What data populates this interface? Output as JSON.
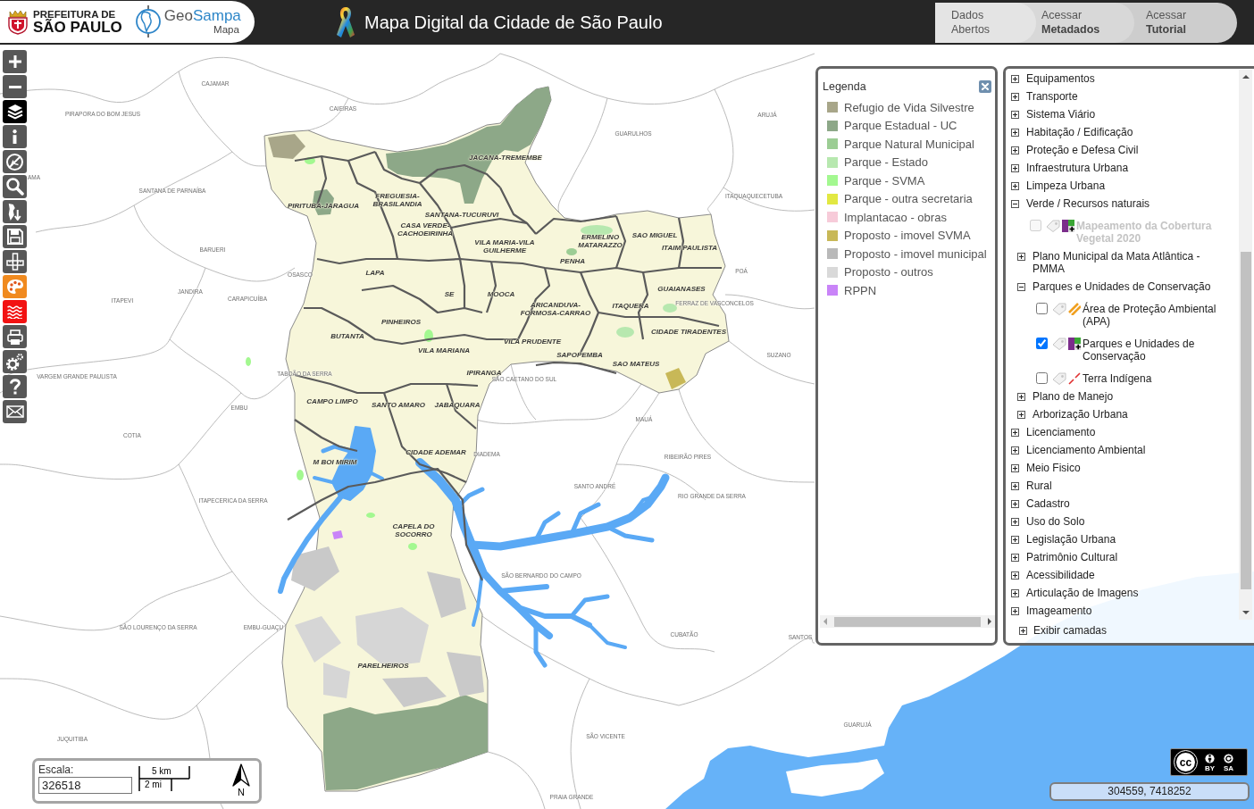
{
  "header": {
    "logo": {
      "line_1": "PREFEITURA DE",
      "line_2": "SÃO PAULO"
    },
    "app_logo": {
      "name_start": "Geo",
      "name_end": "Sampa",
      "subtitle": "Mapa"
    },
    "title": "Mapa Digital da Cidade de São Paulo",
    "links": [
      {
        "label": "Dados Abertos"
      },
      {
        "label": "Acessar **Metadados**"
      },
      {
        "label": "Acessar **Tutorial**"
      }
    ]
  },
  "toolbar": [
    {
      "selected": false
    },
    {
      "selected": false
    },
    {
      "selected": true
    },
    {
      "selected": false
    },
    {
      "selected": false
    },
    {
      "selected": false
    },
    {
      "selected": false
    },
    {
      "selected": false
    },
    {
      "selected": false
    },
    {
      "selected": false,
      "color": "#f08a1f"
    },
    {
      "selected": false,
      "color": "#f21212"
    },
    {
      "selected": false
    },
    {
      "selected": false
    },
    {
      "selected": false
    },
    {
      "selected": false
    }
  ],
  "map": {
    "place_labels": [
      "CAJAMAR",
      "PIRAPORA DO BOM JESUS",
      "CAIEIRAS",
      "ARUJÁ",
      "GUARULHOS",
      "AMA",
      "SANTANA DE PARNAÍBA",
      "ITAQUAQUECETUBA",
      "BARUERI",
      "OSASCO",
      "POÁ",
      "JANDIRA",
      "ITAPEVI",
      "CARAPICUÍBA",
      "FERRAZ DE VASCONCELOS",
      "SUZANO",
      "VARGEM GRANDE PAULISTA",
      "TABOÃO DA SERRA",
      "SÃO CAETANO DO SUL",
      "EMBU",
      "MAUÁ",
      "COTIA",
      "DIADEMA",
      "RIBEIRÃO PIRES",
      "SANTO ANDRÉ",
      "ITAPECERICA DA SERRA",
      "RIO GRANDE DA SERRA",
      "SÃO BERNARDO DO CAMPO",
      "SÃO LOURENÇO DA SERRA",
      "EMBU-GUAÇU",
      "CUBATÃO",
      "SANTOS",
      "GUARUJÁ",
      "JUQUITIBA",
      "SÃO VICENTE",
      "PRAIA GRANDE"
    ],
    "district_labels": [
      "JACANA-TREMEMBE",
      "PIRITUBA-JARAGUA",
      "FREGUESIA-BRASILANDIA",
      "SANTANA-TUCURUVI",
      "CASA VERDE-CACHOEIRINHA",
      "VILA MARIA-VILA GUILHERME",
      "ERMELINO MATARAZZO",
      "SAO MIGUEL",
      "ITAIM PAULISTA",
      "PENHA",
      "LAPA",
      "SE",
      "MOOCA",
      "GUAIANASES",
      "ARICANDUVA-FORMOSA-CARRAO",
      "ITAQUERA",
      "PINHEIROS",
      "BUTANTA",
      "CIDADE TIRADENTES",
      "VILA PRUDENTE",
      "VILA MARIANA",
      "SAPOPEMBA",
      "SAO MATEUS",
      "IPIRANGA",
      "CAMPO LIMPO",
      "SANTO AMARO",
      "JABAQUARA",
      "CIDADE ADEMAR",
      "M BOI MIRIM",
      "CAPELA DO SOCORRO",
      "PARELHEIROS"
    ]
  },
  "legend": {
    "title": "Legenda",
    "items": [
      {
        "label": "Refugio de Vida Silvestre",
        "color": "#a8a689"
      },
      {
        "label": "Parque Estadual - UC",
        "color": "#8da888"
      },
      {
        "label": "Parque Natural Municipal",
        "color": "#9ccd94"
      },
      {
        "label": "Parque - Estado",
        "color": "#b7e8af"
      },
      {
        "label": "Parque - SVMA",
        "color": "#a3f890"
      },
      {
        "label": "Parque - outra secretaria",
        "color": "#e2e842"
      },
      {
        "label": "Implantacao - obras",
        "color": "#f7cbd9"
      },
      {
        "label": "Proposto - imovel SVMA",
        "color": "#c8b857"
      },
      {
        "label": "Proposto - imovel municipal",
        "color": "#b9b9b9"
      },
      {
        "label": "Proposto - outros",
        "color": "#d9d9d9"
      },
      {
        "label": "RPPN",
        "color": "#c984f8"
      }
    ]
  },
  "layers": {
    "items": [
      {
        "kind": "group",
        "label": "Equipamentos",
        "expanded": false
      },
      {
        "kind": "group",
        "label": "Transporte",
        "expanded": false
      },
      {
        "kind": "group",
        "label": "Sistema Viário",
        "expanded": false
      },
      {
        "kind": "group",
        "label": "Habitação / Edificação",
        "expanded": false
      },
      {
        "kind": "group",
        "label": "Proteção e Defesa Civil",
        "expanded": false
      },
      {
        "kind": "group",
        "label": "Infraestrutura Urbana",
        "expanded": false
      },
      {
        "kind": "group",
        "label": "Limpeza Urbana",
        "expanded": false
      },
      {
        "kind": "group",
        "label": "Verde / Recursos naturais",
        "expanded": true,
        "children": [
          {
            "kind": "mosaic",
            "label": "Mapeamento da Cobertura Vegetal 2020",
            "checked": false,
            "disabled": true
          },
          {
            "kind": "group",
            "label": "Plano Municipal da Mata Atlântica - PMMA",
            "expanded": false
          },
          {
            "kind": "group",
            "label": "Parques e Unidades de Conservação",
            "expanded": true,
            "children": [
              {
                "kind": "stripes",
                "label": "Área de Proteção Ambiental (APA)",
                "checked": false,
                "disabled": false
              },
              {
                "kind": "mosaic",
                "label": "Parques e Unidades de Conservação",
                "checked": true,
                "disabled": false
              },
              {
                "kind": "slash",
                "label": "Terra Indígena",
                "checked": false,
                "disabled": false
              }
            ]
          },
          {
            "kind": "group",
            "label": "Plano de Manejo",
            "expanded": false
          },
          {
            "kind": "group",
            "label": "Arborização Urbana",
            "expanded": false
          }
        ]
      },
      {
        "kind": "group",
        "label": "Licenciamento",
        "expanded": false
      },
      {
        "kind": "group",
        "label": "Licenciamento Ambiental",
        "expanded": false
      },
      {
        "kind": "group",
        "label": "Meio Fisico",
        "expanded": false
      },
      {
        "kind": "group",
        "label": "Rural",
        "expanded": false
      },
      {
        "kind": "group",
        "label": "Cadastro",
        "expanded": false
      },
      {
        "kind": "group",
        "label": "Uso do Solo",
        "expanded": false
      },
      {
        "kind": "group",
        "label": "Legislação Urbana",
        "expanded": false
      },
      {
        "kind": "group",
        "label": "Patrimônio Cultural",
        "expanded": false
      },
      {
        "kind": "group",
        "label": "Acessibilidade",
        "expanded": false
      },
      {
        "kind": "group",
        "label": "Articulação de Imagens",
        "expanded": false
      },
      {
        "kind": "group",
        "label": "Imageamento",
        "expanded": false
      }
    ],
    "footer": {
      "label": "Exibir camadas",
      "expanded": false
    }
  },
  "scale": {
    "label": "Escala:",
    "value": "326518",
    "bar_top": "5 km",
    "bar_bottom": "2 mi",
    "north": "N"
  },
  "license": {
    "mark": "cc",
    "by": "BY",
    "sa": "SA"
  },
  "coordinates": "304559, 7418252"
}
